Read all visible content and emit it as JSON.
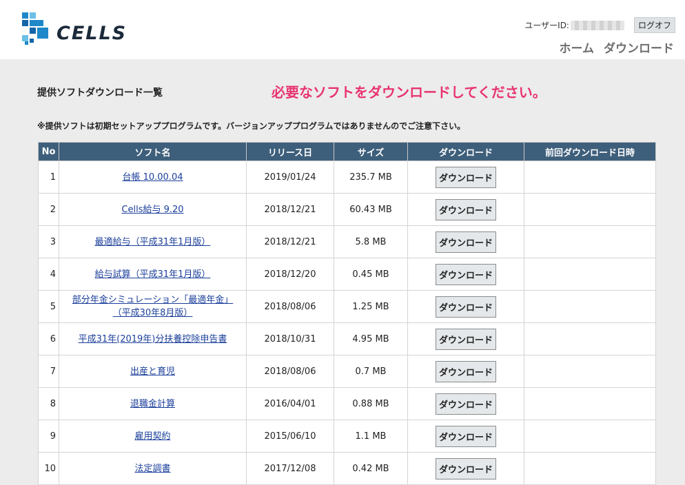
{
  "brand": {
    "name": "CELLS"
  },
  "header": {
    "userid_label": "ユーザーID:",
    "logoff_label": "ログオフ",
    "nav": {
      "home": "ホーム",
      "download": "ダウンロード"
    }
  },
  "main": {
    "title": "提供ソフトダウンロード一覧",
    "instruction": "必要なソフトをダウンロードしてください。",
    "notice": "※提供ソフトは初期セットアッププログラムです。バージョンアッププログラムではありませんのでご注意下さい。",
    "columns": [
      "No",
      "ソフト名",
      "リリース日",
      "サイズ",
      "ダウンロード",
      "前回ダウンロード日時"
    ],
    "download_button_label": "ダウンロード",
    "rows": [
      {
        "no": "1",
        "name": "台帳 10.00.04",
        "date": "2019/01/24",
        "size": "235.7 MB",
        "last": ""
      },
      {
        "no": "2",
        "name": "Cells給与 9.20",
        "date": "2018/12/21",
        "size": "60.43 MB",
        "last": ""
      },
      {
        "no": "3",
        "name": "最適給与（平成31年1月版）",
        "date": "2018/12/21",
        "size": "5.8 MB",
        "last": ""
      },
      {
        "no": "4",
        "name": "給与試算（平成31年1月版）",
        "date": "2018/12/20",
        "size": "0.45 MB",
        "last": ""
      },
      {
        "no": "5",
        "name": "部分年金シミュレーション「最適年金」（平成30年8月版）",
        "date": "2018/08/06",
        "size": "1.25 MB",
        "last": ""
      },
      {
        "no": "6",
        "name": "平成31年(2019年)分扶養控除申告書",
        "date": "2018/10/31",
        "size": "4.95 MB",
        "last": ""
      },
      {
        "no": "7",
        "name": "出産と育児",
        "date": "2018/08/06",
        "size": "0.7 MB",
        "last": ""
      },
      {
        "no": "8",
        "name": "退職金計算",
        "date": "2016/04/01",
        "size": "0.88 MB",
        "last": ""
      },
      {
        "no": "9",
        "name": "雇用契約",
        "date": "2015/06/10",
        "size": "1.1 MB",
        "last": ""
      },
      {
        "no": "10",
        "name": "法定調書",
        "date": "2017/12/08",
        "size": "0.42 MB",
        "last": ""
      }
    ]
  },
  "colors": {
    "header_bg": "#3e5f7b",
    "accent_pink": "#e8336f",
    "link": "#1a3e9a"
  }
}
